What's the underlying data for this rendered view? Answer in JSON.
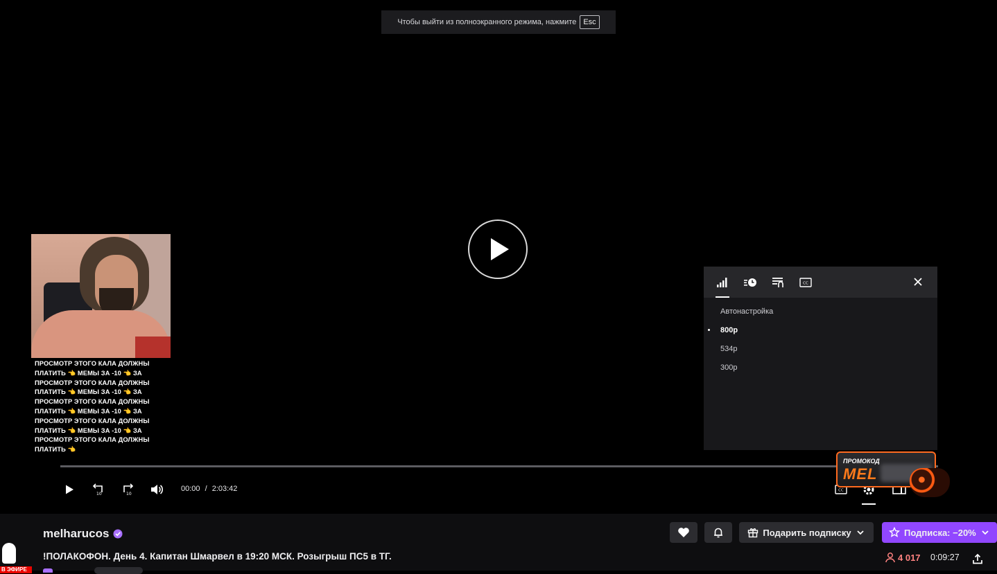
{
  "fullscreen_notice": {
    "text": "Чтобы выйти из полноэкранного режима, нажмите",
    "key": "Esc"
  },
  "chat_overlay": {
    "lines": [
      "ПРОСМОТР ЭТОГО КАЛА ДОЛЖНЫ",
      "ПЛАТИТЬ 👈 МЕМЫ ЗА -10 👈 ЗА",
      "ПРОСМОТР ЭТОГО КАЛА ДОЛЖНЫ",
      "ПЛАТИТЬ 👈 МЕМЫ ЗА -10 👈 ЗА",
      "ПРОСМОТР ЭТОГО КАЛА ДОЛЖНЫ",
      "ПЛАТИТЬ 👈 МЕМЫ ЗА -10 👈 ЗА",
      "ПРОСМОТР ЭТОГО КАЛА ДОЛЖНЫ",
      "ПЛАТИТЬ 👈 МЕМЫ ЗА -10 👈 ЗА",
      "ПРОСМОТР ЭТОГО КАЛА ДОЛЖНЫ",
      "ПЛАТИТЬ 👈"
    ]
  },
  "settings_panel": {
    "tabs": [
      "quality-icon",
      "playback-speed-icon",
      "audio-track-icon",
      "subtitles-icon"
    ],
    "active_tab": "quality-icon",
    "options": [
      "Автонастройка",
      "800p",
      "534p",
      "300p"
    ],
    "selected_option": "800p"
  },
  "player": {
    "current_time": "00:00",
    "separator": "/",
    "duration": "2:03:42",
    "progress": 0
  },
  "promo": {
    "label": "ПРОМОКОД",
    "code": "MEL"
  },
  "channel": {
    "name": "melharucos",
    "verified": true,
    "live_badge": "В ЭФИРЕ",
    "title": "!ПОЛАКОФОН. День 4. Капитан Шмарвел в 19:20 МСК. Розыгрыш ПС5 в ТГ.",
    "viewers": "4 017",
    "uptime": "0:09:27"
  },
  "actions": {
    "gift_label": "Подарить подписку",
    "subscribe_label": "Подписка: −20%"
  },
  "colors": {
    "accent": "#9147ff",
    "live": "#eb0400",
    "viewers": "#ff8280",
    "promo": "#ff6a1f"
  }
}
